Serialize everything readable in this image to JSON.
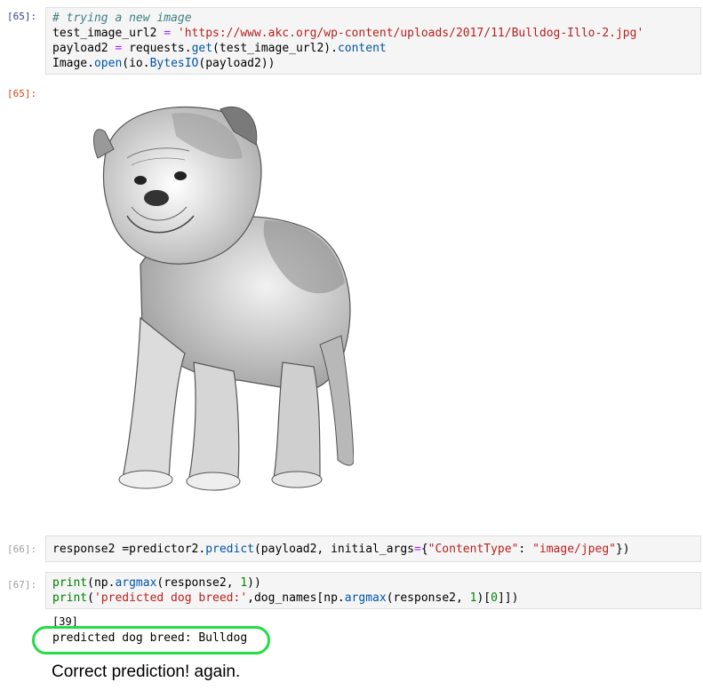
{
  "cells": [
    {
      "prompt": "[65]:",
      "lines": [
        {
          "comment": "# trying a new image"
        },
        {
          "var": "test_image_url2",
          "op": " = ",
          "str": "'https://www.akc.org/wp-content/uploads/2017/11/Bulldog-Illo-2.jpg'"
        },
        {
          "pre": "payload2 ",
          "op": "=",
          "mid": " requests.",
          "fn": "get",
          "post": "(test_image_url2).",
          "fn2": "content"
        },
        {
          "pre": "Image.",
          "fn": "open",
          "post": "(io.",
          "fn2": "BytesIO",
          "post2": "(payload2))"
        }
      ],
      "output_prompt": "[65]:",
      "image_alt": "Bulldog illustration"
    },
    {
      "prompt": "[66]:",
      "line": {
        "pre": "response2 =predictor2.",
        "fn": "predict",
        "post": "(payload2, initial_args",
        "op": "=",
        "post2": "{",
        "str1": "\"ContentType\"",
        "post3": ": ",
        "str2": "\"image/jpeg\"",
        "post4": "})"
      }
    },
    {
      "prompt": "[67]:",
      "line1": {
        "bi": "print",
        "post": "(np.",
        "fn": "argmax",
        "post2": "(response2, ",
        "num": "1",
        "post3": "))"
      },
      "line2": {
        "bi": "print",
        "post": "(",
        "str": "'predicted dog breed:'",
        "post2": ",dog_names[np.",
        "fn": "argmax",
        "post3": "(response2, ",
        "num": "1",
        "post4": ")[",
        "num2": "0",
        "post5": "]])"
      },
      "output_line1": "[39]",
      "output_line2": "predicted dog breed: Bulldog"
    }
  ],
  "note": "Correct prediction! again.",
  "colors": {
    "highlight": "#22dd44",
    "prompt_in": "#303f9f",
    "prompt_out": "#d84315"
  }
}
